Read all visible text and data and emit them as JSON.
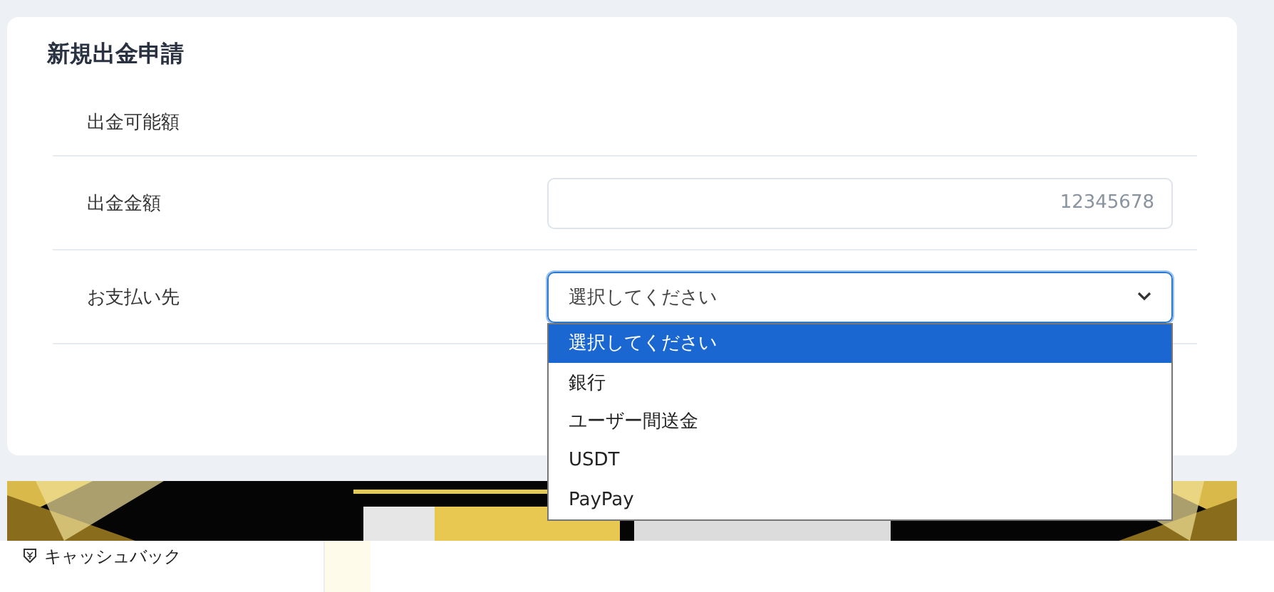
{
  "form": {
    "title": "新規出金申請",
    "rows": [
      {
        "kind": "text",
        "label": "出金可能額"
      },
      {
        "kind": "input",
        "label": "出金金額",
        "placeholder": "12345678"
      },
      {
        "kind": "select",
        "label": "お支払い先",
        "value": "選択してください",
        "expanded": true,
        "options": [
          {
            "label": "選択してください",
            "selected": true
          },
          {
            "label": "銀行",
            "selected": false
          },
          {
            "label": "ユーザー間送金",
            "selected": false
          },
          {
            "label": "USDT",
            "selected": false
          },
          {
            "label": "PayPay",
            "selected": false
          }
        ]
      }
    ]
  },
  "bottom_bar": {
    "items": [
      {
        "label": "キャッシュバック"
      }
    ]
  }
}
